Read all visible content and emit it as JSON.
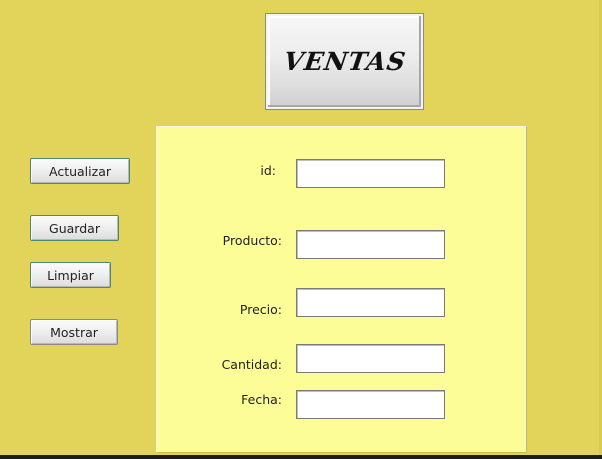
{
  "header": {
    "title_button_label": "VENTAS"
  },
  "actions": {
    "actualizar_label": "Actualizar",
    "guardar_label": "Guardar",
    "limpiar_label": "Limpiar",
    "mostrar_label": "Mostrar"
  },
  "form": {
    "fields": [
      {
        "label": "id:",
        "value": ""
      },
      {
        "label": "Producto:",
        "value": ""
      },
      {
        "label": "Precio:",
        "value": ""
      },
      {
        "label": "Cantidad:",
        "value": ""
      },
      {
        "label": "Fecha:",
        "value": ""
      }
    ]
  },
  "colors": {
    "window_background": "#e2d45a",
    "panel_background": "#fdfd98"
  }
}
